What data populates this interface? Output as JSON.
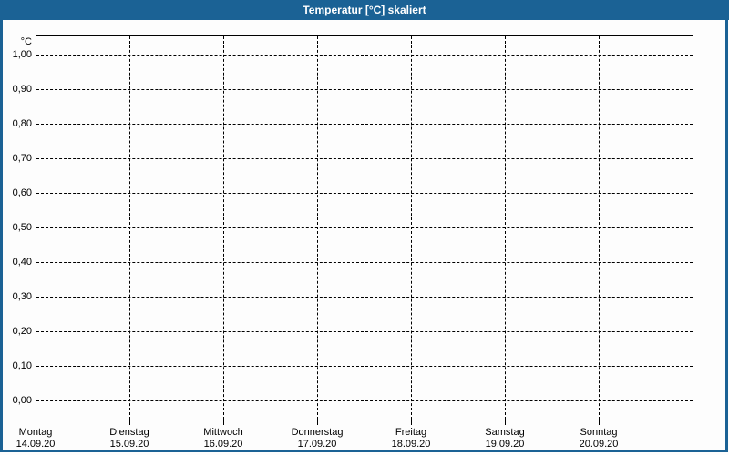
{
  "window": {
    "title": "Temperatur [°C] skaliert"
  },
  "colors": {
    "frame_and_titlebar": "#1b6295",
    "titlebar_text": "#ffffff",
    "plot_background": "#fdfdfd",
    "grid_and_text": "#000000"
  },
  "chart_data": {
    "type": "line",
    "title": "Temperatur [°C] skaliert",
    "series": [],
    "note": "Plot area is empty — axes and dashed grid only, no data series drawn",
    "grid": "dashed black, on",
    "legend": "none",
    "y_axis": {
      "unit": "°C",
      "min": 0.0,
      "max": 1.0,
      "step": 0.1,
      "ylim": [
        0.0,
        1.0
      ],
      "tick_labels_top_to_bottom": [
        "1,00",
        "0,90",
        "0,80",
        "0,70",
        "0,60",
        "0,50",
        "0,40",
        "0,30",
        "0,20",
        "0,10",
        "0,00"
      ]
    },
    "x_axis": {
      "categories": [
        {
          "day": "Montag",
          "date": "14.09.20"
        },
        {
          "day": "Dienstag",
          "date": "15.09.20"
        },
        {
          "day": "Mittwoch",
          "date": "16.09.20"
        },
        {
          "day": "Donnerstag",
          "date": "17.09.20"
        },
        {
          "day": "Freitag",
          "date": "18.09.20"
        },
        {
          "day": "Samstag",
          "date": "19.09.20"
        },
        {
          "day": "Sonntag",
          "date": "20.09.20"
        }
      ]
    }
  }
}
